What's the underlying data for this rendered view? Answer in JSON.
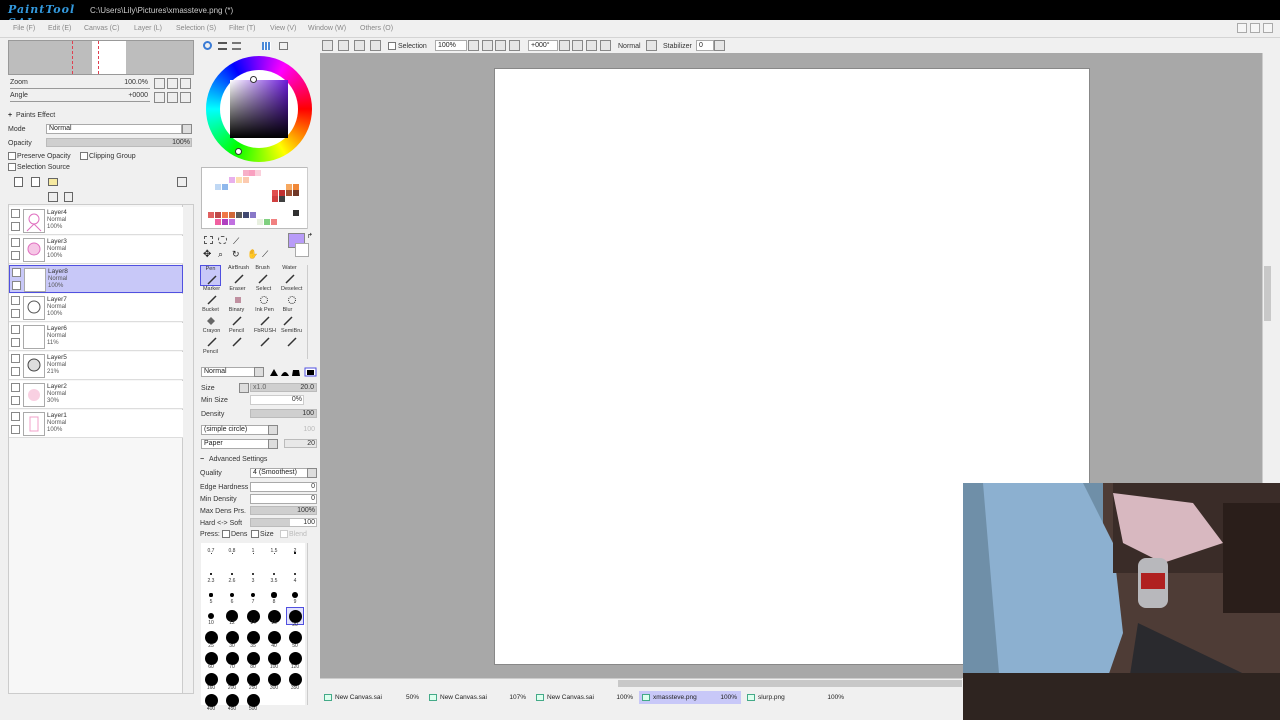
{
  "window": {
    "app_logo": "PaintTool SAI",
    "title": "C:\\Users\\Lily\\Pictures\\xmassteve.png (*)"
  },
  "menu": [
    "File (F)",
    "Edit (E)",
    "Canvas (C)",
    "Layer (L)",
    "Selection (S)",
    "Filter (T)",
    "View (V)",
    "Window (W)",
    "Others (O)"
  ],
  "navigator": {
    "zoom_label": "Zoom",
    "zoom_value": "100.0%",
    "angle_label": "Angle",
    "angle_value": "+0000"
  },
  "paints_effect": {
    "header": "Paints Effect",
    "mode_label": "Mode",
    "mode_value": "Normal",
    "opacity_label": "Opacity",
    "opacity_value": "100%",
    "preserve_opacity": "Preserve Opacity",
    "clipping_group": "Clipping Group",
    "selection_source": "Selection Source"
  },
  "layers": [
    {
      "name": "Layer4",
      "mode": "Normal",
      "opacity": "100%",
      "selected": false
    },
    {
      "name": "Layer3",
      "mode": "Normal",
      "opacity": "100%",
      "selected": false
    },
    {
      "name": "Layer8",
      "mode": "Normal",
      "opacity": "100%",
      "selected": true
    },
    {
      "name": "Layer7",
      "mode": "Normal",
      "opacity": "100%",
      "selected": false
    },
    {
      "name": "Layer6",
      "mode": "Normal",
      "opacity": "11%",
      "selected": false
    },
    {
      "name": "Layer5",
      "mode": "Normal",
      "opacity": "21%",
      "selected": false
    },
    {
      "name": "Layer2",
      "mode": "Normal",
      "opacity": "30%",
      "selected": false
    },
    {
      "name": "Layer1",
      "mode": "Normal",
      "opacity": "100%",
      "selected": false
    }
  ],
  "colors": {
    "accent": "#c8c8f8",
    "accent_border": "#5050e0",
    "current_color": "#b89cf8",
    "canvas_bg": "#a8a8a8"
  },
  "tools": [
    {
      "label": "Pen",
      "selected": true
    },
    {
      "label": "AirBrush",
      "selected": false
    },
    {
      "label": "Brush",
      "selected": false
    },
    {
      "label": "Water",
      "selected": false
    },
    {
      "label": "Marker",
      "selected": false
    },
    {
      "label": "Eraser",
      "selected": false
    },
    {
      "label": "Select",
      "selected": false
    },
    {
      "label": "Deselect",
      "selected": false
    },
    {
      "label": "Bucket",
      "selected": false
    },
    {
      "label": "Binary",
      "selected": false
    },
    {
      "label": "Ink Pen",
      "selected": false
    },
    {
      "label": "Blur",
      "selected": false
    },
    {
      "label": "Crayon",
      "selected": false
    },
    {
      "label": "Pencil",
      "selected": false
    },
    {
      "label": "FbRUSH",
      "selected": false
    },
    {
      "label": "SemiBru",
      "selected": false
    },
    {
      "label": "Pencil",
      "selected": false
    }
  ],
  "brush": {
    "blend_mode": "Normal",
    "size_label": "Size",
    "size_mult": "x1.0",
    "size_value": "20.0",
    "min_size_label": "Min Size",
    "min_size_value": "0%",
    "density_label": "Density",
    "density_value": "100",
    "shape": "(simple circle)",
    "shape_value": "100",
    "texture": "Paper",
    "texture_value": "20"
  },
  "advanced": {
    "header": "Advanced Settings",
    "quality_label": "Quality",
    "quality_value": "4 (Smoothest)",
    "edge_label": "Edge Hardness",
    "edge_value": "0",
    "min_density_label": "Min Density",
    "min_density_value": "0",
    "max_dens_label": "Max Dens Prs.",
    "max_dens_value": "100%",
    "hard_soft_label": "Hard <-> Soft",
    "hard_soft_value": "100",
    "press_label": "Press:",
    "press_dens": "Dens",
    "press_size": "Size",
    "press_blend": "Blend"
  },
  "brush_sizes": [
    "0.7",
    "0.8",
    "1",
    "1.5",
    "2",
    "2.3",
    "2.6",
    "3",
    "3.5",
    "4",
    "5",
    "6",
    "7",
    "8",
    "9",
    "10",
    "12",
    "14",
    "16",
    "20",
    "25",
    "30",
    "35",
    "40",
    "50",
    "60",
    "70",
    "80",
    "100",
    "120",
    "160",
    "200",
    "250",
    "300",
    "350",
    "400",
    "450",
    "500"
  ],
  "toolbar": {
    "selection_label": "Selection",
    "zoom_value": "100%",
    "angle_value": "+000°",
    "blend_value": "Normal",
    "stabilizer_label": "Stabilizer",
    "stabilizer_value": "0"
  },
  "canvas_tabs": [
    {
      "name": "New Canvas.sai",
      "zoom": "50%",
      "active": false
    },
    {
      "name": "New Canvas.sai",
      "zoom": "107%",
      "active": false
    },
    {
      "name": "New Canvas.sai",
      "zoom": "100%",
      "active": false
    },
    {
      "name": "xmassteve.png",
      "zoom": "100%",
      "active": true
    },
    {
      "name": "slurp.png",
      "zoom": "100%",
      "active": false
    }
  ]
}
